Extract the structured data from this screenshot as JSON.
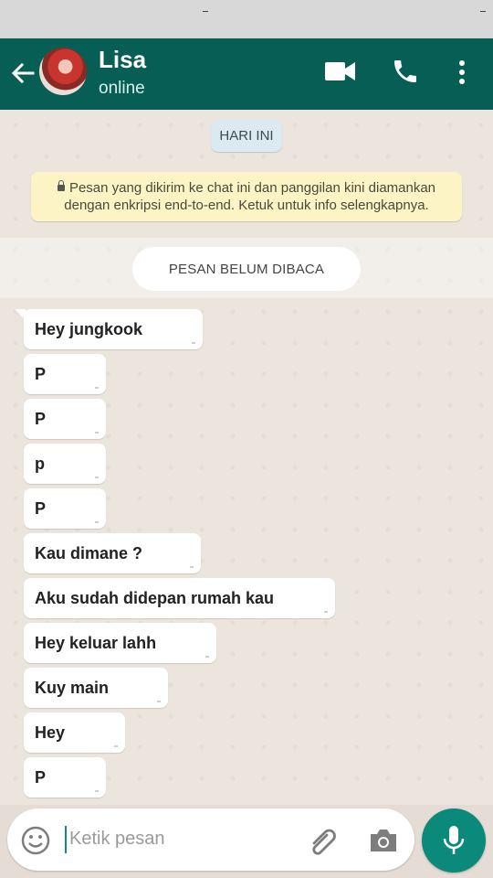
{
  "header": {
    "contact_name": "Lisa",
    "contact_status": "online",
    "icons": [
      "back-arrow-icon",
      "video-call-icon",
      "phone-icon",
      "more-options-icon"
    ]
  },
  "chat": {
    "date_chip": "HARI INI",
    "encryption_notice_line1": "Pesan yang dikirim ke chat ini dan panggilan kini diamankan",
    "encryption_notice_line2": "dengan enkripsi end-to-end. Ketuk untuk info selengkapnya.",
    "unread_label": "PESAN BELUM DIBACA",
    "messages": [
      {
        "text": "Hey jungkook"
      },
      {
        "text": "P"
      },
      {
        "text": "P"
      },
      {
        "text": "p"
      },
      {
        "text": "P"
      },
      {
        "text": "Kau dimane ?"
      },
      {
        "text": "Aku sudah didepan rumah kau"
      },
      {
        "text": "Hey keluar lahh"
      },
      {
        "text": "Kuy main"
      },
      {
        "text": "Hey"
      },
      {
        "text": "P"
      }
    ]
  },
  "composer": {
    "placeholder": "Ketik pesan",
    "icons": [
      "emoji-icon",
      "attach-icon",
      "camera-icon",
      "mic-icon"
    ]
  },
  "colors": {
    "header": "#075e54",
    "accent": "#128c7e",
    "mic_button": "#0b8a7c",
    "notice_bg": "#fcf4c4",
    "date_chip_bg": "#dbe9f1"
  }
}
